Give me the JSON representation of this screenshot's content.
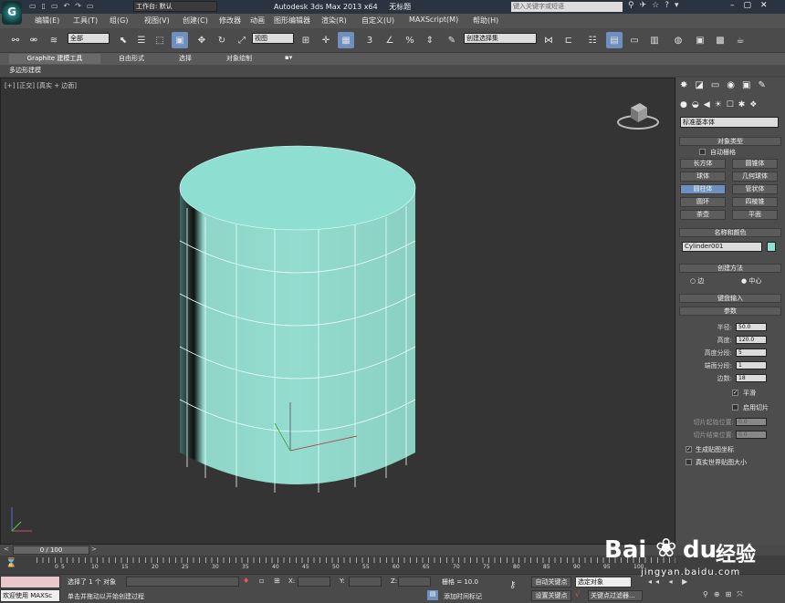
{
  "title": {
    "app": "Autodesk 3ds Max  2013 x64",
    "file": "无标题",
    "workspace": "工作台: 默认",
    "search_placeholder": "键入关键字或短语"
  },
  "menu": [
    "编辑(E)",
    "工具(T)",
    "组(G)",
    "视图(V)",
    "创建(C)",
    "修改器",
    "动画",
    "图形编辑器",
    "渲染(R)",
    "自定义(U)",
    "MAXScript(M)",
    "帮助(H)"
  ],
  "toolbar": {
    "filter": "全部",
    "view": "视图",
    "selection_set": "创建选择集"
  },
  "ribbon": {
    "tabs": [
      "Graphite 建模工具",
      "自由形式",
      "选择",
      "对象绘制"
    ],
    "sub": "多边形建模"
  },
  "viewport": {
    "label": "[+] [正交] [真实 + 边面]"
  },
  "cmd": {
    "category": "标准基本体",
    "object_type": {
      "header": "对象类型",
      "autogrid": "自动栅格",
      "buttons": [
        "长方体",
        "圆锥体",
        "球体",
        "几何球体",
        "圆柱体",
        "管状体",
        "圆环",
        "四棱锥",
        "茶壶",
        "平面"
      ]
    },
    "name_color": {
      "header": "名称和颜色",
      "name": "Cylinder001",
      "color": "#8ee0d0"
    },
    "creation": {
      "header": "创建方法",
      "edge": "边",
      "center": "中心"
    },
    "keyboard": {
      "header": "键盘输入"
    },
    "params": {
      "header": "参数",
      "rows": [
        {
          "label": "半径:",
          "value": "50.0"
        },
        {
          "label": "高度:",
          "value": "120.0"
        },
        {
          "label": "高度分段:",
          "value": "5"
        },
        {
          "label": "端面分段:",
          "value": "1"
        },
        {
          "label": "边数:",
          "value": "18"
        }
      ],
      "smooth": "平滑",
      "slice_on": "启用切片",
      "slice_from": {
        "label": "切片起始位置:",
        "value": "0.0"
      },
      "slice_to": {
        "label": "切片结束位置:",
        "value": "0.0"
      },
      "gen_uv": "生成贴图坐标",
      "real_world": "真实世界贴图大小"
    }
  },
  "timeline": {
    "frame": "0 / 100",
    "ticks": [
      "0",
      "5",
      "10",
      "15",
      "20",
      "25",
      "30",
      "35",
      "40",
      "45",
      "50",
      "55",
      "60",
      "65",
      "70",
      "75",
      "80",
      "85",
      "90",
      "95",
      "100"
    ]
  },
  "status": {
    "welcome": "欢迎使用 MAXSc",
    "selected": "选择了 1 个 对象",
    "prompt": "单击并拖动以开始创建过程",
    "x": "X:",
    "y": "Y:",
    "z": "Z:",
    "grid": "栅格 = 10.0",
    "add_time_tag": "添加时间标记",
    "auto_key": "自动关键点",
    "set_key": "设置关键点",
    "selected_obj": "选定对象",
    "key_filters": "关键点过滤器..."
  },
  "watermark": {
    "brand": "Bai",
    "brand2": "du",
    "cn": "经验",
    "url": "jingyan.baidu.com"
  }
}
